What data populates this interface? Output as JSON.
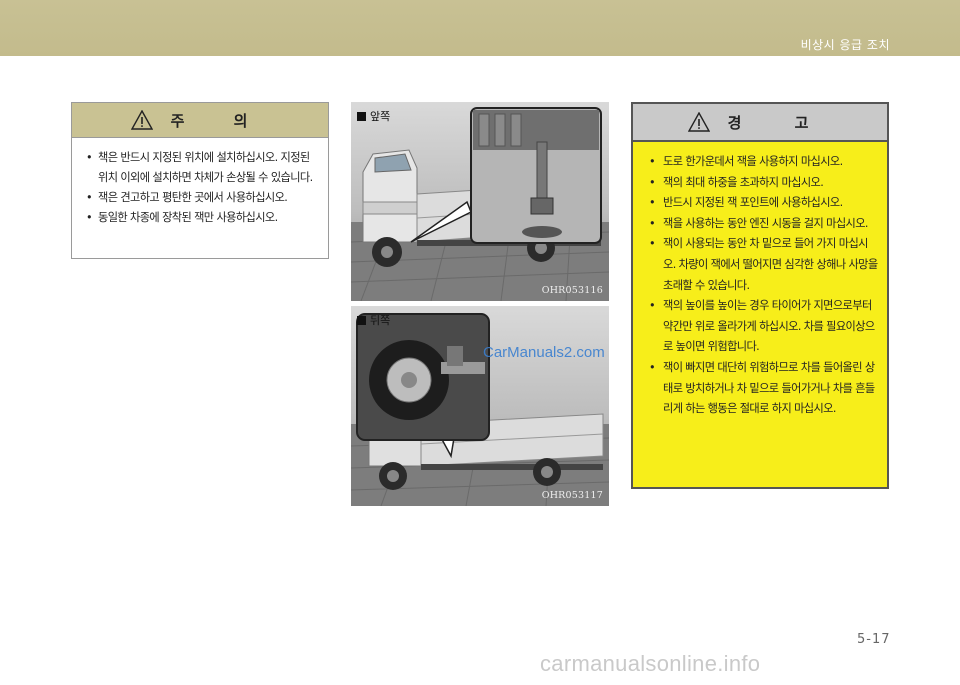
{
  "header": {
    "section_title": "비상시 응급 조치"
  },
  "caution": {
    "title": "주  의",
    "items": [
      "책은 반드시 지정된 위치에 설치하십시오. 지정된 위치 이외에 설치하면 차체가 손상될 수 있습니다.",
      "잭은 견고하고 평탄한 곳에서 사용하십시오.",
      "동일한 차종에 장착된 잭만 사용하십시오."
    ]
  },
  "photos": {
    "front": {
      "label": "앞쪽",
      "code": "OHR053116"
    },
    "rear": {
      "label": "뒤쪽",
      "code": "OHR053117"
    }
  },
  "warning": {
    "title": "경  고",
    "items": [
      "도로 한가운데서 잭을 사용하지 마십시오.",
      "잭의 최대 하중을 초과하지 마십시오.",
      "반드시 지정된 잭 포인트에 사용하십시오.",
      "잭을 사용하는 동안 엔진 시동을 걸지 마십시오.",
      "잭이 사용되는 동안 차 밑으로 들어 가지 마십시오. 차량이 잭에서 떨어지면 심각한 상해나 사망을 초래할 수 있습니다.",
      "잭의 높이를 높이는 경우 타이어가 지면으로부터 약간만 위로 올라가게 하십시오. 차를 필요이상으로 높이면 위험합니다.",
      "잭이 빠지면 대단히 위험하므로 차를 들어올린 상태로 방치하거나 차 밑으로 들어가거나 차를 흔들리게 하는 행동은 절대로 하지 마십시오."
    ]
  },
  "page_number": "5-17",
  "watermarks": {
    "inline": "CarManuals2.com",
    "footer": "carmanualsonline.info"
  },
  "colors": {
    "header_band": "#c3bb8c",
    "caution_header": "#c9c293",
    "warning_bg": "#f7ee1a",
    "warning_header": "#c9c9c9"
  }
}
